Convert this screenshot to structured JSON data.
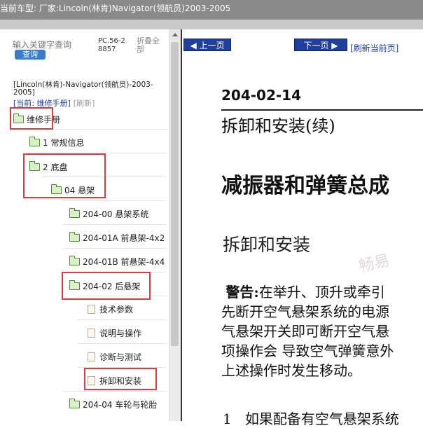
{
  "window": {
    "title": "当前车型:  厂家:Lincoln(林肯)Navigator(领航员)2003-2005"
  },
  "sidebar": {
    "search_placeholder": "输入关键字查询",
    "search_button": "查询",
    "pc_code": "PC.56-28857",
    "collapse_all": "折叠全部",
    "vehicle": "[Lincoln(林肯)-Navigator(领航员)-2003-2005]",
    "current_label": "[当前: 维修手册]",
    "refresh_label": "[刷新]",
    "tree": [
      {
        "label": "维修手册",
        "type": "folder"
      },
      {
        "label": "1 常规信息",
        "type": "folder"
      },
      {
        "label": "2 底盘",
        "type": "folder"
      },
      {
        "label": "04 悬架",
        "type": "folder"
      },
      {
        "label": "204-00 悬架系统",
        "type": "folder"
      },
      {
        "label": "204-01A 前悬架-4x2",
        "type": "folder"
      },
      {
        "label": "204-01B 前悬架-4x4",
        "type": "folder"
      },
      {
        "label": "204-02 后悬架",
        "type": "folder"
      },
      {
        "label": "技术参数",
        "type": "doc"
      },
      {
        "label": "说明与操作",
        "type": "doc"
      },
      {
        "label": "诊断与测试",
        "type": "doc"
      },
      {
        "label": "拆卸和安装",
        "type": "doc"
      },
      {
        "label": "204-04 车轮与轮胎",
        "type": "folder"
      }
    ]
  },
  "content": {
    "prev_page": "上一页",
    "next_page": "下一页",
    "refresh_page": "[刷新当前页]",
    "section_number": "204-02-14",
    "subtitle": "拆卸和安装(续)",
    "heading": "减振器和弹簧总成",
    "subheading": "拆卸和安装",
    "warning_prefix": "警告:",
    "warning_line1": "在举升、顶升或牵引",
    "warning_line2": "先断开空气悬架系统的电源",
    "warning_line3": "气悬架开关即可断开空气悬",
    "warning_line4": "项操作会 导致空气弹簧意外",
    "warning_line5": "上述操作时发生移动。",
    "step_number": "1",
    "step_text": "如果配备有空气悬架系统",
    "watermark": "畅易"
  }
}
